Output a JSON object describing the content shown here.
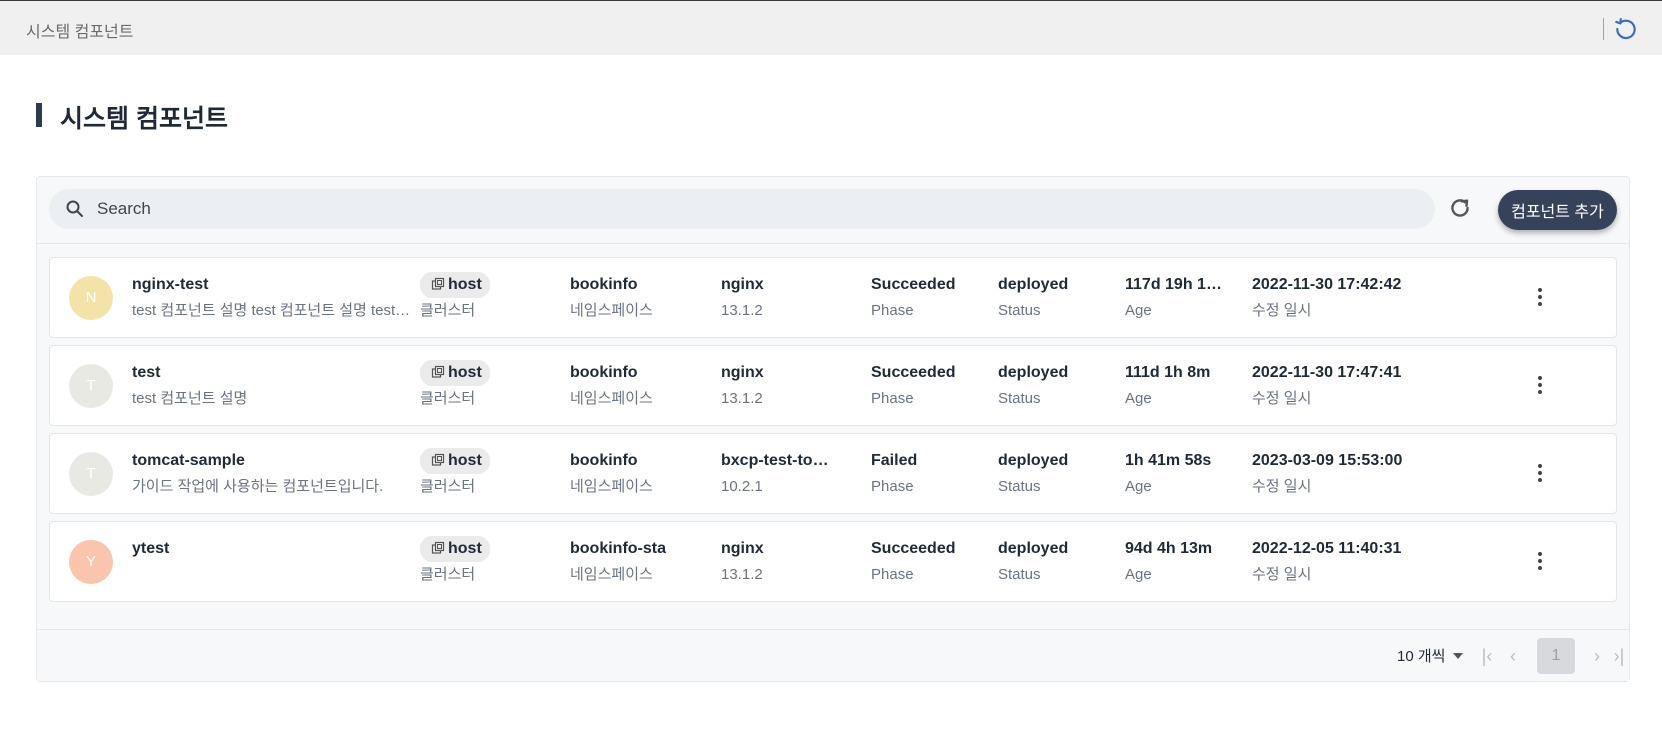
{
  "topbar": {
    "breadcrumb": "시스템 컴포넌트"
  },
  "page": {
    "title": "시스템 컴포넌트"
  },
  "toolbar": {
    "search_placeholder": "Search",
    "add_button": "컴포넌트 추가"
  },
  "labels": {
    "cluster": "클러스터",
    "namespace": "네임스페이스",
    "phase": "Phase",
    "status": "Status",
    "age": "Age",
    "modified": "수정 일시"
  },
  "rows": [
    {
      "initial": "N",
      "avatar_color": "#f3e3a9",
      "name": "nginx-test",
      "description": "test 컴포넌트 설명 test 컴포넌트 설명 test 컴포넌트 설명",
      "cluster": "host",
      "namespace": "bookinfo",
      "chart": "nginx",
      "version": "13.1.2",
      "phase": "Succeeded",
      "status": "deployed",
      "age": "117d 19h 1…",
      "modified": "2022-11-30 17:42:42"
    },
    {
      "initial": "T",
      "avatar_color": "#e9e9e4",
      "name": "test",
      "description": "test 컴포넌트 설명",
      "cluster": "host",
      "namespace": "bookinfo",
      "chart": "nginx",
      "version": "13.1.2",
      "phase": "Succeeded",
      "status": "deployed",
      "age": "111d 1h 8m",
      "modified": "2022-11-30 17:47:41"
    },
    {
      "initial": "T",
      "avatar_color": "#e9e9e4",
      "name": "tomcat-sample",
      "description": "가이드 작업에 사용하는 컴포넌트입니다.",
      "cluster": "host",
      "namespace": "bookinfo",
      "chart": "bxcp-test-tom…",
      "version": "10.2.1",
      "phase": "Failed",
      "status": "deployed",
      "age": "1h 41m 58s",
      "modified": "2023-03-09 15:53:00"
    },
    {
      "initial": "Y",
      "avatar_color": "#fbc4ad",
      "name": "ytest",
      "description": "",
      "cluster": "host",
      "namespace": "bookinfo-sta",
      "chart": "nginx",
      "version": "13.1.2",
      "phase": "Succeeded",
      "status": "deployed",
      "age": "94d 4h 13m",
      "modified": "2022-12-05 11:40:31"
    }
  ],
  "pagination": {
    "page_size": "10 개씩",
    "current_page": "1",
    "first": "|‹",
    "prev": "‹",
    "next": "›",
    "last": "›|"
  }
}
